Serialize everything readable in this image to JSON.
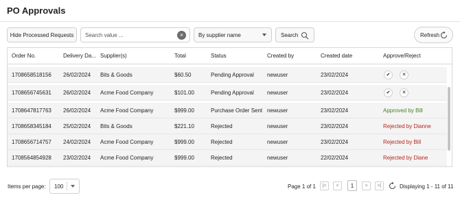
{
  "page": {
    "title": "PO Approvals"
  },
  "toolbar": {
    "hide_processed_label": "Hide Processed Requests",
    "search_placeholder": "Search value ...",
    "search_clear_icon": "close-circle-icon",
    "filter_selected": "By supplier name",
    "search_label": "Search",
    "search_icon": "magnifier-icon",
    "refresh_label": "Refresh",
    "refresh_icon": "refresh-icon"
  },
  "table": {
    "columns": [
      "Order No.",
      "Delivery Da...",
      "Supplier(s)",
      "Total",
      "Status",
      "Created by",
      "Created date",
      "Approve/Reject"
    ],
    "rows": [
      {
        "order_no": "1708658518156",
        "delivery_date": "26/02/2024",
        "supplier": "Bits & Goods",
        "total": "$60.50",
        "status": "Pending Approval",
        "created_by": "newuser",
        "created_date": "23/02/2024",
        "approve_label": "✔",
        "reject_label": "✕",
        "result": ""
      },
      {
        "order_no": "1708656745631",
        "delivery_date": "26/02/2024",
        "supplier": "Acme Food Company",
        "total": "$101.00",
        "status": "Pending Approval",
        "created_by": "newuser",
        "created_date": "23/02/2024",
        "approve_label": "✔",
        "reject_label": "✕",
        "result": ""
      },
      {
        "order_no": "1708647817763",
        "delivery_date": "26/02/2024",
        "supplier": "Acme Food Company",
        "total": "$999.00",
        "status": "Purchase Order Sent",
        "created_by": "newuser",
        "created_date": "23/02/2024",
        "result": "Approved by Bill",
        "result_kind": "approved"
      },
      {
        "order_no": "1708658345184",
        "delivery_date": "25/02/2024",
        "supplier": "Bits & Goods",
        "total": "$221.10",
        "status": "Rejected",
        "created_by": "newuser",
        "created_date": "23/02/2024",
        "result": "Rejected by Dianne",
        "result_kind": "rejected"
      },
      {
        "order_no": "1708656714757",
        "delivery_date": "24/02/2024",
        "supplier": "Acme Food Company",
        "total": "$999.00",
        "status": "Rejected",
        "created_by": "newuser",
        "created_date": "23/02/2024",
        "result": "Rejected by Bill",
        "result_kind": "rejected"
      },
      {
        "order_no": "1708564854928",
        "delivery_date": "23/02/2024",
        "supplier": "Acme Food Company",
        "total": "$999.00",
        "status": "Rejected",
        "created_by": "newuser",
        "created_date": "22/02/2024",
        "result": "Rejected by Diane",
        "result_kind": "rejected"
      }
    ]
  },
  "colors": {
    "approved": "#4a7f2a",
    "rejected": "#b3261e"
  },
  "footer": {
    "items_per_page_label": "Items per page:",
    "items_per_page_value": "100",
    "page_label": "Page 1 of 1",
    "first_icon": "first-page-icon",
    "prev_icon": "prev-page-icon",
    "current_page": "1",
    "next_icon": "next-page-icon",
    "last_icon": "last-page-icon",
    "refresh_icon": "refresh-icon",
    "display_label": "Displaying 1 - 11 of 11"
  }
}
